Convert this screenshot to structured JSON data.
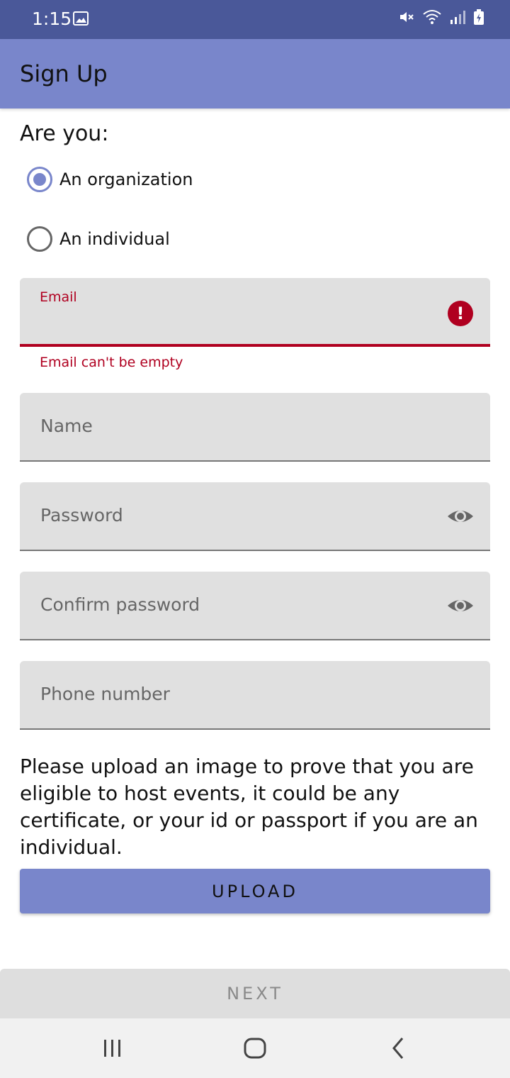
{
  "status_bar": {
    "time": "1:15",
    "icons": [
      "gallery-icon",
      "mute-icon",
      "wifi-icon",
      "signal-icon",
      "battery-icon"
    ]
  },
  "app_bar": {
    "title": "Sign Up",
    "color": "#7986cb"
  },
  "form": {
    "question": "Are you:",
    "options": [
      {
        "label": "An organization",
        "selected": true
      },
      {
        "label": "An individual",
        "selected": false
      }
    ],
    "email": {
      "label": "Email",
      "error": "Email can't be empty",
      "error_color": "#b00020"
    },
    "name": {
      "placeholder": "Name"
    },
    "password": {
      "placeholder": "Password",
      "icon": "eye-icon"
    },
    "confirm_password": {
      "placeholder": "Confirm password",
      "icon": "eye-icon"
    },
    "phone": {
      "placeholder": "Phone number"
    },
    "upload_text": "Please upload an image to prove that you are eligible to host events, it could be any certificate, or your id or passport if you are an individual.",
    "upload_label": "UPLOAD",
    "next_label": "NEXT"
  },
  "nav_bar": {
    "icons": [
      "recents-icon",
      "home-icon",
      "back-icon"
    ]
  }
}
